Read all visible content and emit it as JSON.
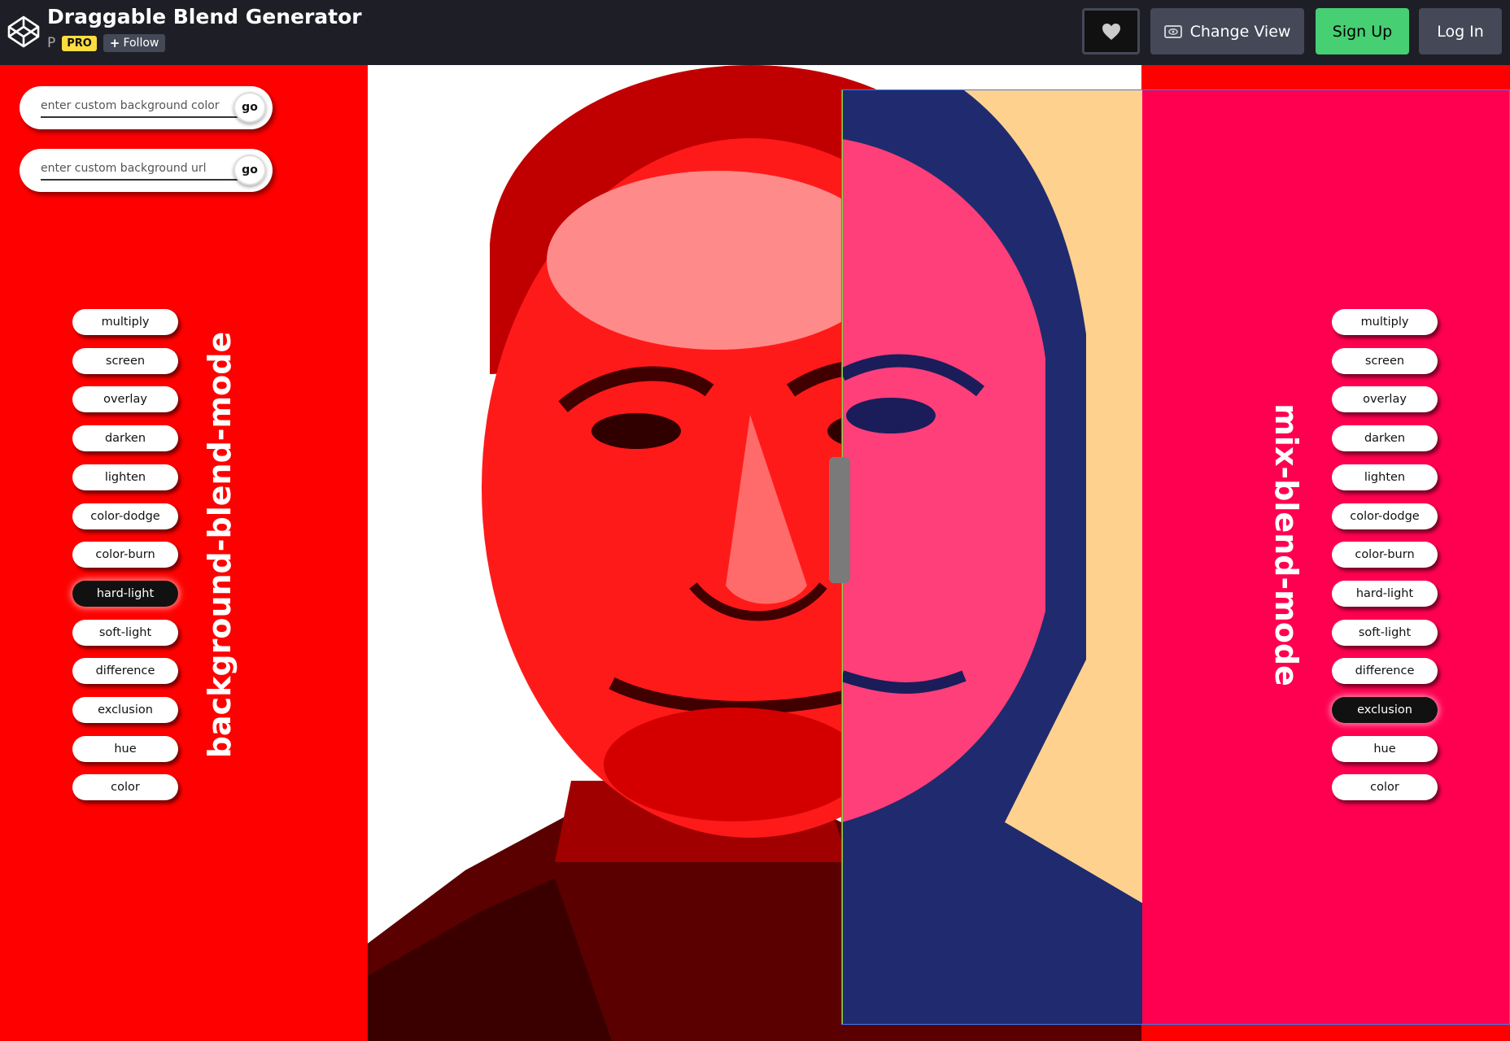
{
  "header": {
    "title": "Draggable Blend Generator",
    "owner": "P",
    "pro_badge": "PRO",
    "follow_label": "Follow",
    "change_view_label": "Change View",
    "signup_label": "Sign Up",
    "login_label": "Log In"
  },
  "controls": {
    "bg_color_placeholder": "enter custom background color",
    "bg_url_placeholder": "enter custom background url",
    "go_label": "go"
  },
  "background_blend": {
    "heading": "background-blend-mode",
    "modes": [
      "multiply",
      "screen",
      "overlay",
      "darken",
      "lighten",
      "color-dodge",
      "color-burn",
      "hard-light",
      "soft-light",
      "difference",
      "exclusion",
      "hue",
      "color"
    ],
    "active": "hard-light"
  },
  "mix_blend": {
    "heading": "mix-blend-mode",
    "modes": [
      "multiply",
      "screen",
      "overlay",
      "darken",
      "lighten",
      "color-dodge",
      "color-burn",
      "hard-light",
      "soft-light",
      "difference",
      "exclusion",
      "hue",
      "color"
    ],
    "active": "exclusion"
  },
  "colors": {
    "header_bg": "#1e1f26",
    "stage_red": "#ff0000",
    "mix_pink": "#ff0050",
    "mix_peach": "#ffd18f",
    "signup_green": "#47cf73",
    "pro_yellow": "#ffdd40"
  },
  "icons": [
    "codepen-logo-icon",
    "heart-icon",
    "eye-icon",
    "plus-icon"
  ]
}
